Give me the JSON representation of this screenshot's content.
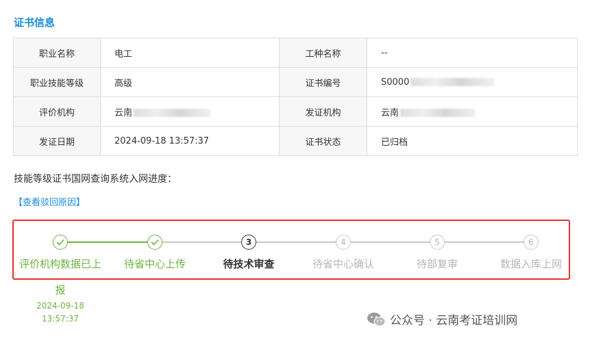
{
  "section_title": "证书信息",
  "info_rows": [
    {
      "l1": "职业名称",
      "v1": "电工",
      "l2": "工种名称",
      "v2": "--"
    },
    {
      "l1": "职业技能等级",
      "v1": "高级",
      "l2": "证书编号",
      "v2": "S0000"
    },
    {
      "l1": "评价机构",
      "v1": "云南",
      "l2": "发证机构",
      "v2": "云南"
    },
    {
      "l1": "发证日期",
      "v1": "2024-09-18 13:57:37",
      "l2": "证书状态",
      "v2": "已归档"
    }
  ],
  "progress_title": "技能等级证书国网查询系统入网进度：",
  "reject_link": "【查看驳回原因】",
  "steps": [
    {
      "num": "1",
      "label": "评价机构数据已上",
      "label_cont": "报",
      "status": "done",
      "date": "2024-09-18",
      "time": "13:57:37"
    },
    {
      "num": "2",
      "label": "待省中心上传",
      "status": "done"
    },
    {
      "num": "3",
      "label": "待技术审查",
      "status": "active"
    },
    {
      "num": "4",
      "label": "待省中心确认",
      "status": "pending"
    },
    {
      "num": "5",
      "label": "待部复审",
      "status": "pending"
    },
    {
      "num": "6",
      "label": "数据入库上网",
      "status": "pending"
    }
  ],
  "watermark": "公众号 · 云南考证培训网",
  "colors": {
    "accent": "#1a8ce0",
    "done": "#6cb33e",
    "highlight": "#e8302a",
    "pending": "#b5b5b5"
  }
}
